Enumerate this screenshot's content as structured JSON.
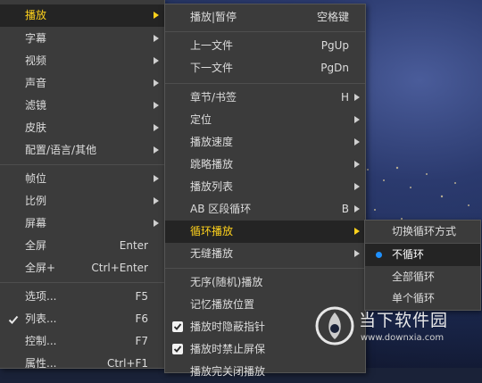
{
  "main_menu": {
    "items": [
      {
        "label": "播放",
        "shortcut": "",
        "submenu": true,
        "highlighted": true
      },
      {
        "label": "字幕",
        "shortcut": "",
        "submenu": true
      },
      {
        "label": "视频",
        "shortcut": "",
        "submenu": true
      },
      {
        "label": "声音",
        "shortcut": "",
        "submenu": true
      },
      {
        "label": "滤镜",
        "shortcut": "",
        "submenu": true
      },
      {
        "label": "皮肤",
        "shortcut": "",
        "submenu": true
      },
      {
        "label": "配置/语言/其他",
        "shortcut": "",
        "submenu": true
      },
      {
        "label": "帧位",
        "shortcut": "",
        "submenu": true
      },
      {
        "label": "比例",
        "shortcut": "",
        "submenu": true
      },
      {
        "label": "屏幕",
        "shortcut": "",
        "submenu": true
      },
      {
        "label": "全屏",
        "shortcut": "Enter"
      },
      {
        "label": "全屏+",
        "shortcut": "Ctrl+Enter"
      },
      {
        "label": "选项...",
        "shortcut": "F5"
      },
      {
        "label": "列表...",
        "shortcut": "F6",
        "checked": true
      },
      {
        "label": "控制...",
        "shortcut": "F7"
      },
      {
        "label": "属性...",
        "shortcut": "Ctrl+F1"
      }
    ]
  },
  "play_menu": {
    "items": [
      {
        "label": "播放|暂停",
        "shortcut": "空格键"
      },
      {
        "label": "上一文件",
        "shortcut": "PgUp"
      },
      {
        "label": "下一文件",
        "shortcut": "PgDn"
      },
      {
        "label": "章节/书签",
        "shortcut": "H",
        "submenu": true
      },
      {
        "label": "定位",
        "shortcut": "",
        "submenu": true
      },
      {
        "label": "播放速度",
        "shortcut": "",
        "submenu": true
      },
      {
        "label": "跳略播放",
        "shortcut": "",
        "submenu": true
      },
      {
        "label": "播放列表",
        "shortcut": "",
        "submenu": true
      },
      {
        "label": "AB 区段循环",
        "shortcut": "B",
        "submenu": true
      },
      {
        "label": "循环播放",
        "shortcut": "",
        "submenu": true,
        "highlighted": true
      },
      {
        "label": "无缝播放",
        "shortcut": "",
        "submenu": true
      },
      {
        "label": "无序(随机)播放",
        "shortcut": ""
      },
      {
        "label": "记忆播放位置",
        "shortcut": ""
      },
      {
        "label": "播放时隐蔽指针",
        "shortcut": "",
        "checked": true
      },
      {
        "label": "播放时禁止屏保",
        "shortcut": "",
        "checked": true
      },
      {
        "label": "播放完关闭播放",
        "shortcut": ""
      }
    ]
  },
  "loop_menu": {
    "items": [
      {
        "label": "切换循环方式"
      },
      {
        "label": "不循环",
        "selected": true,
        "highlighted": true
      },
      {
        "label": "全部循环"
      },
      {
        "label": "单个循环"
      }
    ]
  },
  "watermark": {
    "brand": "当下软件园",
    "url": "www.downxia.com"
  },
  "colors": {
    "menu_bg": "#3b3b3b",
    "highlight_bg": "#242424",
    "highlight_text": "#ffd21c",
    "radio": "#1e90ff"
  }
}
